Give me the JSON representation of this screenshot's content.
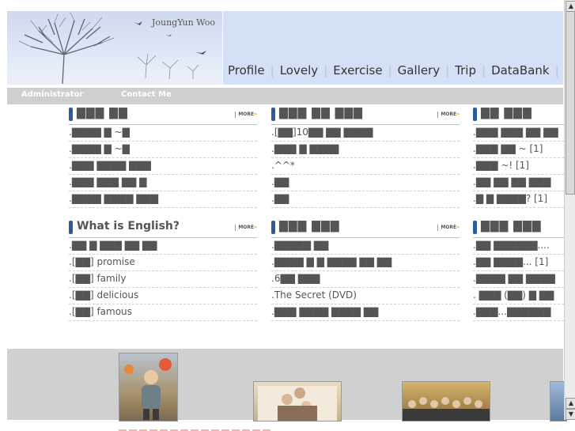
{
  "header": {
    "logo_text": "JoungYun Woo",
    "nav": [
      "Profile",
      "Lovely",
      "Exercise",
      "Gallery",
      "Trip",
      "DataBank"
    ]
  },
  "subbar": {
    "links": [
      "Administrator",
      "Contact Me"
    ]
  },
  "more_label": "MORE",
  "boxes": [
    {
      "title": "▇▇▇ ▇▇",
      "items": [
        ".▇▇▇▇ ▇ ~▇",
        ".▇▇▇▇ ▇ ~▇",
        ".▇▇▇ ▇▇▇▇ ▇▇▇",
        ".▇▇▇ ▇▇▇ ▇▇ ▇",
        ".▇▇▇▇ ▇▇▇▇ ▇▇▇"
      ]
    },
    {
      "title": "▇▇▇ ▇▇ ▇▇▇",
      "items": [
        ".[▇▇]10▇▇ ▇▇ ▇▇▇▇",
        ".▇▇▇ ▇ ▇▇▇▇",
        ".^^*",
        ".▇▇",
        ".▇▇"
      ]
    },
    {
      "title": "▇▇ ▇▇▇",
      "items": [
        ".▇▇▇ ▇▇▇ ▇▇ ▇▇",
        ".▇▇▇ ▇▇ ~ [1]",
        ".▇▇▇ ~! [1]",
        ".▇▇ ▇▇ ▇▇ ▇▇▇",
        ".▇ ▇ ▇▇▇▇? [1]"
      ]
    },
    {
      "title": "What is English?",
      "items": [
        ".▇▇ ▇ ▇▇▇ ▇▇ ▇▇",
        ".[▇▇] promise",
        ".[▇▇] family",
        ".[▇▇] delicious",
        ".[▇▇] famous"
      ]
    },
    {
      "title": "▇▇▇ ▇▇▇",
      "items": [
        ".▇▇▇▇▇ ▇▇",
        ".▇▇▇▇ ▇ ▇ ▇▇▇▇ ▇▇ ▇▇",
        ".6▇▇ ▇▇▇",
        ".The Secret (DVD)",
        ".▇▇▇ ▇▇▇▇ ▇▇▇▇ ▇▇"
      ]
    },
    {
      "title": "▇▇▇ ▇▇▇",
      "items": [
        ".▇▇ ▇▇▇▇▇▇....",
        ".▇▇ ▇▇▇▇... [1]",
        ".▇▇▇▇ ▇▇ ▇▇▇▇",
        ". ▇▇▇ (▇▇) ▇ ▇▇",
        ".▇▇▇...▇▇▇▇▇▇"
      ]
    }
  ],
  "colors": {
    "nav_bg": "#d4e0f6",
    "subbar_bg": "#cfcfcf",
    "accent_bar": "#2c5d9a",
    "more_arrow": "#f39c12"
  },
  "icons": {
    "scroll_up": "▲",
    "scroll_down": "▼"
  }
}
